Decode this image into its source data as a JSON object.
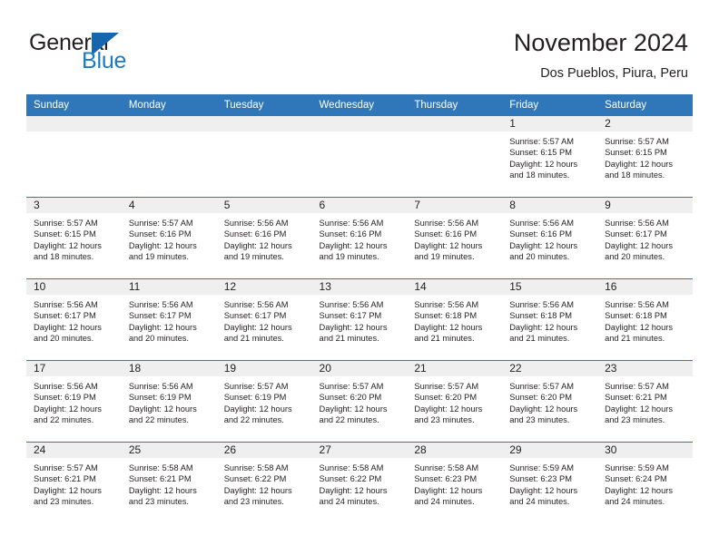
{
  "brand": {
    "name_part1": "General",
    "name_part2": "Blue",
    "triangle_icon": "triangle-icon",
    "color_dark": "#231f20",
    "color_blue": "#1c7ac0"
  },
  "header": {
    "title": "November 2024",
    "subtitle": "Dos Pueblos, Piura, Peru",
    "accent_color": "#2f77b8",
    "band_color": "#efefef"
  },
  "calendar": {
    "weekday_headers": [
      "Sunday",
      "Monday",
      "Tuesday",
      "Wednesday",
      "Thursday",
      "Friday",
      "Saturday"
    ],
    "weeks": [
      [
        {
          "day": "",
          "empty": true,
          "sunrise": "",
          "sunset": "",
          "daylight_line1": "",
          "daylight_line2": ""
        },
        {
          "day": "",
          "empty": true,
          "sunrise": "",
          "sunset": "",
          "daylight_line1": "",
          "daylight_line2": ""
        },
        {
          "day": "",
          "empty": true,
          "sunrise": "",
          "sunset": "",
          "daylight_line1": "",
          "daylight_line2": ""
        },
        {
          "day": "",
          "empty": true,
          "sunrise": "",
          "sunset": "",
          "daylight_line1": "",
          "daylight_line2": ""
        },
        {
          "day": "",
          "empty": true,
          "sunrise": "",
          "sunset": "",
          "daylight_line1": "",
          "daylight_line2": ""
        },
        {
          "day": "1",
          "empty": false,
          "sunrise": "Sunrise: 5:57 AM",
          "sunset": "Sunset: 6:15 PM",
          "daylight_line1": "Daylight: 12 hours",
          "daylight_line2": "and 18 minutes."
        },
        {
          "day": "2",
          "empty": false,
          "sunrise": "Sunrise: 5:57 AM",
          "sunset": "Sunset: 6:15 PM",
          "daylight_line1": "Daylight: 12 hours",
          "daylight_line2": "and 18 minutes."
        }
      ],
      [
        {
          "day": "3",
          "empty": false,
          "sunrise": "Sunrise: 5:57 AM",
          "sunset": "Sunset: 6:15 PM",
          "daylight_line1": "Daylight: 12 hours",
          "daylight_line2": "and 18 minutes."
        },
        {
          "day": "4",
          "empty": false,
          "sunrise": "Sunrise: 5:57 AM",
          "sunset": "Sunset: 6:16 PM",
          "daylight_line1": "Daylight: 12 hours",
          "daylight_line2": "and 19 minutes."
        },
        {
          "day": "5",
          "empty": false,
          "sunrise": "Sunrise: 5:56 AM",
          "sunset": "Sunset: 6:16 PM",
          "daylight_line1": "Daylight: 12 hours",
          "daylight_line2": "and 19 minutes."
        },
        {
          "day": "6",
          "empty": false,
          "sunrise": "Sunrise: 5:56 AM",
          "sunset": "Sunset: 6:16 PM",
          "daylight_line1": "Daylight: 12 hours",
          "daylight_line2": "and 19 minutes."
        },
        {
          "day": "7",
          "empty": false,
          "sunrise": "Sunrise: 5:56 AM",
          "sunset": "Sunset: 6:16 PM",
          "daylight_line1": "Daylight: 12 hours",
          "daylight_line2": "and 19 minutes."
        },
        {
          "day": "8",
          "empty": false,
          "sunrise": "Sunrise: 5:56 AM",
          "sunset": "Sunset: 6:16 PM",
          "daylight_line1": "Daylight: 12 hours",
          "daylight_line2": "and 20 minutes."
        },
        {
          "day": "9",
          "empty": false,
          "sunrise": "Sunrise: 5:56 AM",
          "sunset": "Sunset: 6:17 PM",
          "daylight_line1": "Daylight: 12 hours",
          "daylight_line2": "and 20 minutes."
        }
      ],
      [
        {
          "day": "10",
          "empty": false,
          "sunrise": "Sunrise: 5:56 AM",
          "sunset": "Sunset: 6:17 PM",
          "daylight_line1": "Daylight: 12 hours",
          "daylight_line2": "and 20 minutes."
        },
        {
          "day": "11",
          "empty": false,
          "sunrise": "Sunrise: 5:56 AM",
          "sunset": "Sunset: 6:17 PM",
          "daylight_line1": "Daylight: 12 hours",
          "daylight_line2": "and 20 minutes."
        },
        {
          "day": "12",
          "empty": false,
          "sunrise": "Sunrise: 5:56 AM",
          "sunset": "Sunset: 6:17 PM",
          "daylight_line1": "Daylight: 12 hours",
          "daylight_line2": "and 21 minutes."
        },
        {
          "day": "13",
          "empty": false,
          "sunrise": "Sunrise: 5:56 AM",
          "sunset": "Sunset: 6:17 PM",
          "daylight_line1": "Daylight: 12 hours",
          "daylight_line2": "and 21 minutes."
        },
        {
          "day": "14",
          "empty": false,
          "sunrise": "Sunrise: 5:56 AM",
          "sunset": "Sunset: 6:18 PM",
          "daylight_line1": "Daylight: 12 hours",
          "daylight_line2": "and 21 minutes."
        },
        {
          "day": "15",
          "empty": false,
          "sunrise": "Sunrise: 5:56 AM",
          "sunset": "Sunset: 6:18 PM",
          "daylight_line1": "Daylight: 12 hours",
          "daylight_line2": "and 21 minutes."
        },
        {
          "day": "16",
          "empty": false,
          "sunrise": "Sunrise: 5:56 AM",
          "sunset": "Sunset: 6:18 PM",
          "daylight_line1": "Daylight: 12 hours",
          "daylight_line2": "and 21 minutes."
        }
      ],
      [
        {
          "day": "17",
          "empty": false,
          "sunrise": "Sunrise: 5:56 AM",
          "sunset": "Sunset: 6:19 PM",
          "daylight_line1": "Daylight: 12 hours",
          "daylight_line2": "and 22 minutes."
        },
        {
          "day": "18",
          "empty": false,
          "sunrise": "Sunrise: 5:56 AM",
          "sunset": "Sunset: 6:19 PM",
          "daylight_line1": "Daylight: 12 hours",
          "daylight_line2": "and 22 minutes."
        },
        {
          "day": "19",
          "empty": false,
          "sunrise": "Sunrise: 5:57 AM",
          "sunset": "Sunset: 6:19 PM",
          "daylight_line1": "Daylight: 12 hours",
          "daylight_line2": "and 22 minutes."
        },
        {
          "day": "20",
          "empty": false,
          "sunrise": "Sunrise: 5:57 AM",
          "sunset": "Sunset: 6:20 PM",
          "daylight_line1": "Daylight: 12 hours",
          "daylight_line2": "and 22 minutes."
        },
        {
          "day": "21",
          "empty": false,
          "sunrise": "Sunrise: 5:57 AM",
          "sunset": "Sunset: 6:20 PM",
          "daylight_line1": "Daylight: 12 hours",
          "daylight_line2": "and 23 minutes."
        },
        {
          "day": "22",
          "empty": false,
          "sunrise": "Sunrise: 5:57 AM",
          "sunset": "Sunset: 6:20 PM",
          "daylight_line1": "Daylight: 12 hours",
          "daylight_line2": "and 23 minutes."
        },
        {
          "day": "23",
          "empty": false,
          "sunrise": "Sunrise: 5:57 AM",
          "sunset": "Sunset: 6:21 PM",
          "daylight_line1": "Daylight: 12 hours",
          "daylight_line2": "and 23 minutes."
        }
      ],
      [
        {
          "day": "24",
          "empty": false,
          "sunrise": "Sunrise: 5:57 AM",
          "sunset": "Sunset: 6:21 PM",
          "daylight_line1": "Daylight: 12 hours",
          "daylight_line2": "and 23 minutes."
        },
        {
          "day": "25",
          "empty": false,
          "sunrise": "Sunrise: 5:58 AM",
          "sunset": "Sunset: 6:21 PM",
          "daylight_line1": "Daylight: 12 hours",
          "daylight_line2": "and 23 minutes."
        },
        {
          "day": "26",
          "empty": false,
          "sunrise": "Sunrise: 5:58 AM",
          "sunset": "Sunset: 6:22 PM",
          "daylight_line1": "Daylight: 12 hours",
          "daylight_line2": "and 23 minutes."
        },
        {
          "day": "27",
          "empty": false,
          "sunrise": "Sunrise: 5:58 AM",
          "sunset": "Sunset: 6:22 PM",
          "daylight_line1": "Daylight: 12 hours",
          "daylight_line2": "and 24 minutes."
        },
        {
          "day": "28",
          "empty": false,
          "sunrise": "Sunrise: 5:58 AM",
          "sunset": "Sunset: 6:23 PM",
          "daylight_line1": "Daylight: 12 hours",
          "daylight_line2": "and 24 minutes."
        },
        {
          "day": "29",
          "empty": false,
          "sunrise": "Sunrise: 5:59 AM",
          "sunset": "Sunset: 6:23 PM",
          "daylight_line1": "Daylight: 12 hours",
          "daylight_line2": "and 24 minutes."
        },
        {
          "day": "30",
          "empty": false,
          "sunrise": "Sunrise: 5:59 AM",
          "sunset": "Sunset: 6:24 PM",
          "daylight_line1": "Daylight: 12 hours",
          "daylight_line2": "and 24 minutes."
        }
      ]
    ]
  }
}
